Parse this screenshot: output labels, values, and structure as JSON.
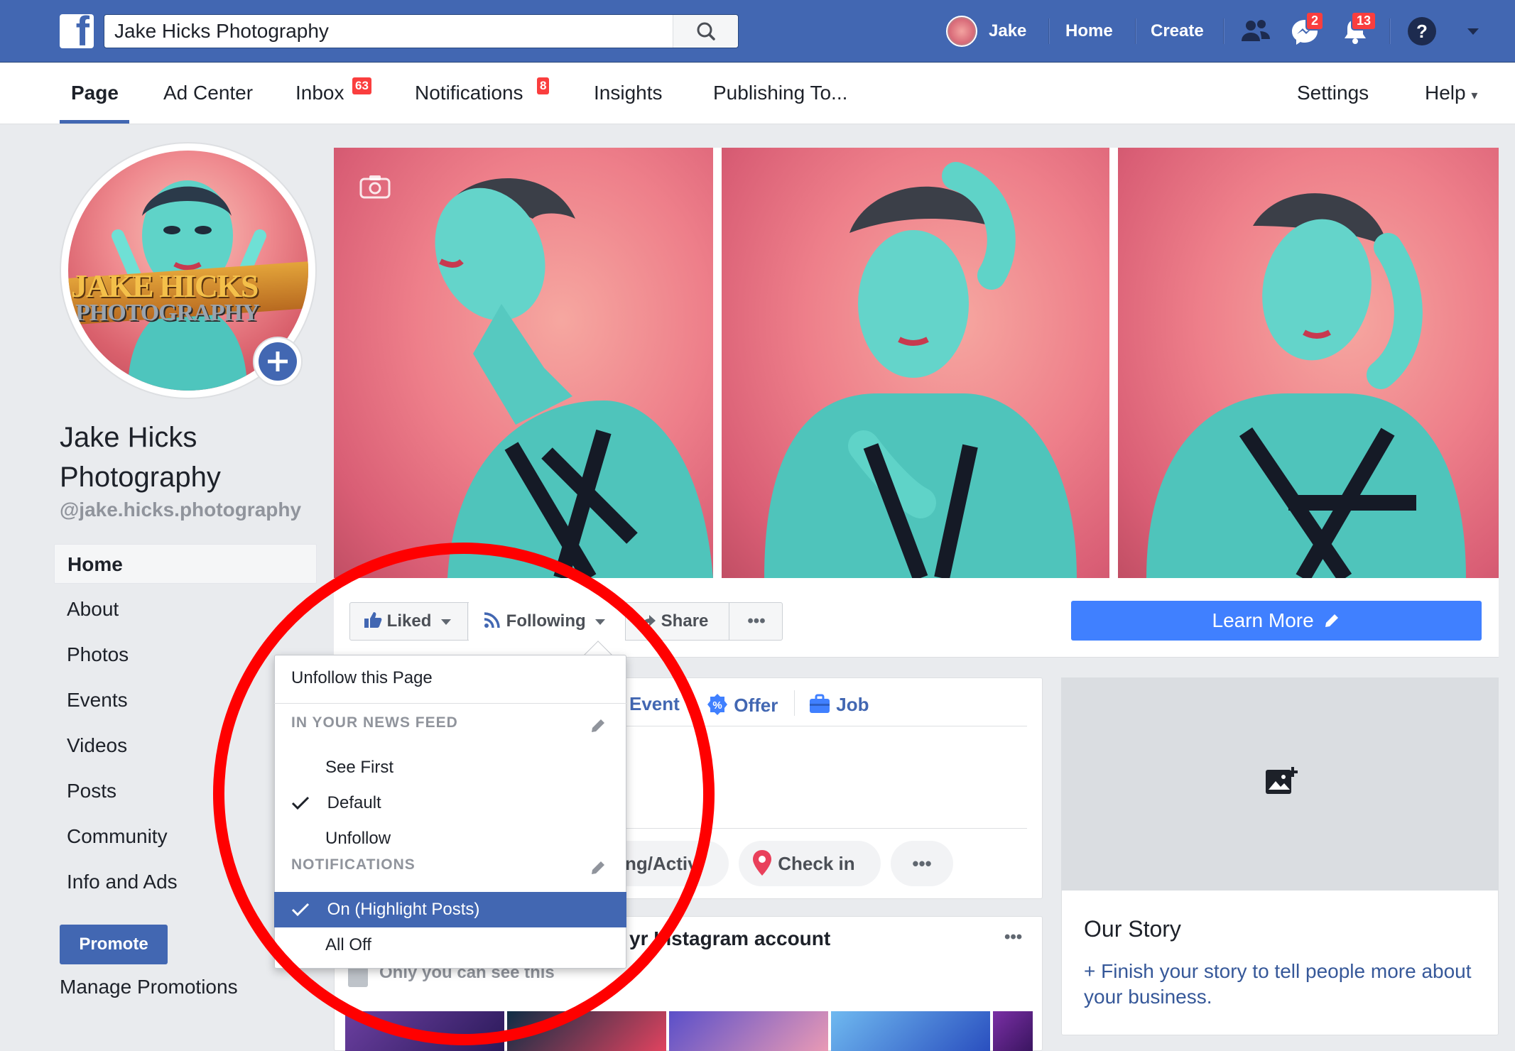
{
  "topbar": {
    "logo_letter": "f",
    "search_value": "Jake Hicks Photography",
    "user_name": "Jake",
    "home_label": "Home",
    "create_label": "Create",
    "messenger_count": "2",
    "notification_count": "13",
    "help_glyph": "?"
  },
  "page_nav": {
    "items": [
      "Page",
      "Ad Center",
      "Inbox",
      "Notifications",
      "Insights",
      "Publishing To...",
      "Settings",
      "Help"
    ],
    "inbox_badge": "63",
    "notifications_badge": "8",
    "help_caret": "▾"
  },
  "profile": {
    "name_line1": "Jake Hicks",
    "name_line2": "Photography",
    "handle": "@jake.hicks.photography",
    "logo_text_1": "JAKE HICKS",
    "logo_text_2": "PHOTOGRAPHY"
  },
  "sidebar": {
    "items": [
      "Home",
      "About",
      "Photos",
      "Events",
      "Videos",
      "Posts",
      "Community",
      "Info and Ads"
    ],
    "promote_label": "Promote",
    "manage_promotions": "Manage Promotions"
  },
  "actions": {
    "liked": "Liked",
    "following": "Following",
    "share": "Share",
    "more": "•••",
    "learn_more": "Learn More"
  },
  "composer": {
    "event": "Event",
    "offer": "Offer",
    "job": "Job",
    "activity_fragment": "ng/Activ",
    "check_in": "Check in",
    "more": "•••"
  },
  "instagram_card": {
    "title_fragment": "r Instagram account",
    "title_prefix": "y",
    "subtitle": "Only you can see this",
    "more": "•••"
  },
  "story": {
    "title": "Our Story",
    "text": "+ Finish your story to tell people more about your business."
  },
  "dropdown": {
    "unfollow": "Unfollow this Page",
    "news_feed_header": "IN YOUR NEWS FEED",
    "news_feed_options": [
      "See First",
      "Default",
      "Unfollow"
    ],
    "news_feed_selected": "Default",
    "notifications_header": "NOTIFICATIONS",
    "notification_options": [
      "On (Highlight Posts)",
      "All Off"
    ],
    "notifications_selected": "On (Highlight Posts)"
  },
  "colors": {
    "brand_blue": "#4267b2",
    "learn_more_blue": "#4080ff",
    "badge_red": "#fa3e3e",
    "annotation_red": "#ff0000",
    "cover_pink": "#ee7f8a",
    "skin_teal": "#5fd3c8"
  },
  "icons": [
    "facebook-logo-icon",
    "search-icon",
    "friends-icon",
    "messenger-icon",
    "bell-icon",
    "help-icon",
    "caret-down-icon",
    "camera-icon",
    "thumbs-up-icon",
    "rss-icon",
    "share-arrow-icon",
    "pencil-icon",
    "offer-icon",
    "briefcase-icon",
    "location-pin-icon",
    "add-photo-icon",
    "checkmark-icon",
    "plus-icon"
  ]
}
